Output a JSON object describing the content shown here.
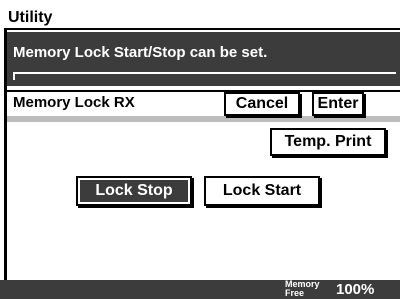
{
  "header": {
    "title": "Utility"
  },
  "message": {
    "text": "Memory Lock Start/Stop can be set."
  },
  "panel": {
    "title": "Memory Lock RX",
    "cancel_label": "Cancel",
    "enter_label": "Enter",
    "temp_print_label": "Temp. Print"
  },
  "options": {
    "lock_stop_label": "Lock Stop",
    "lock_start_label": "Lock Start",
    "selected": "Lock Stop"
  },
  "footer": {
    "memory_label_top": "Memory",
    "memory_label_bottom": "Free",
    "memory_value": "100%"
  },
  "colors": {
    "dark_panel": "#3c3c3c",
    "stripe": "#bdbdbd"
  }
}
